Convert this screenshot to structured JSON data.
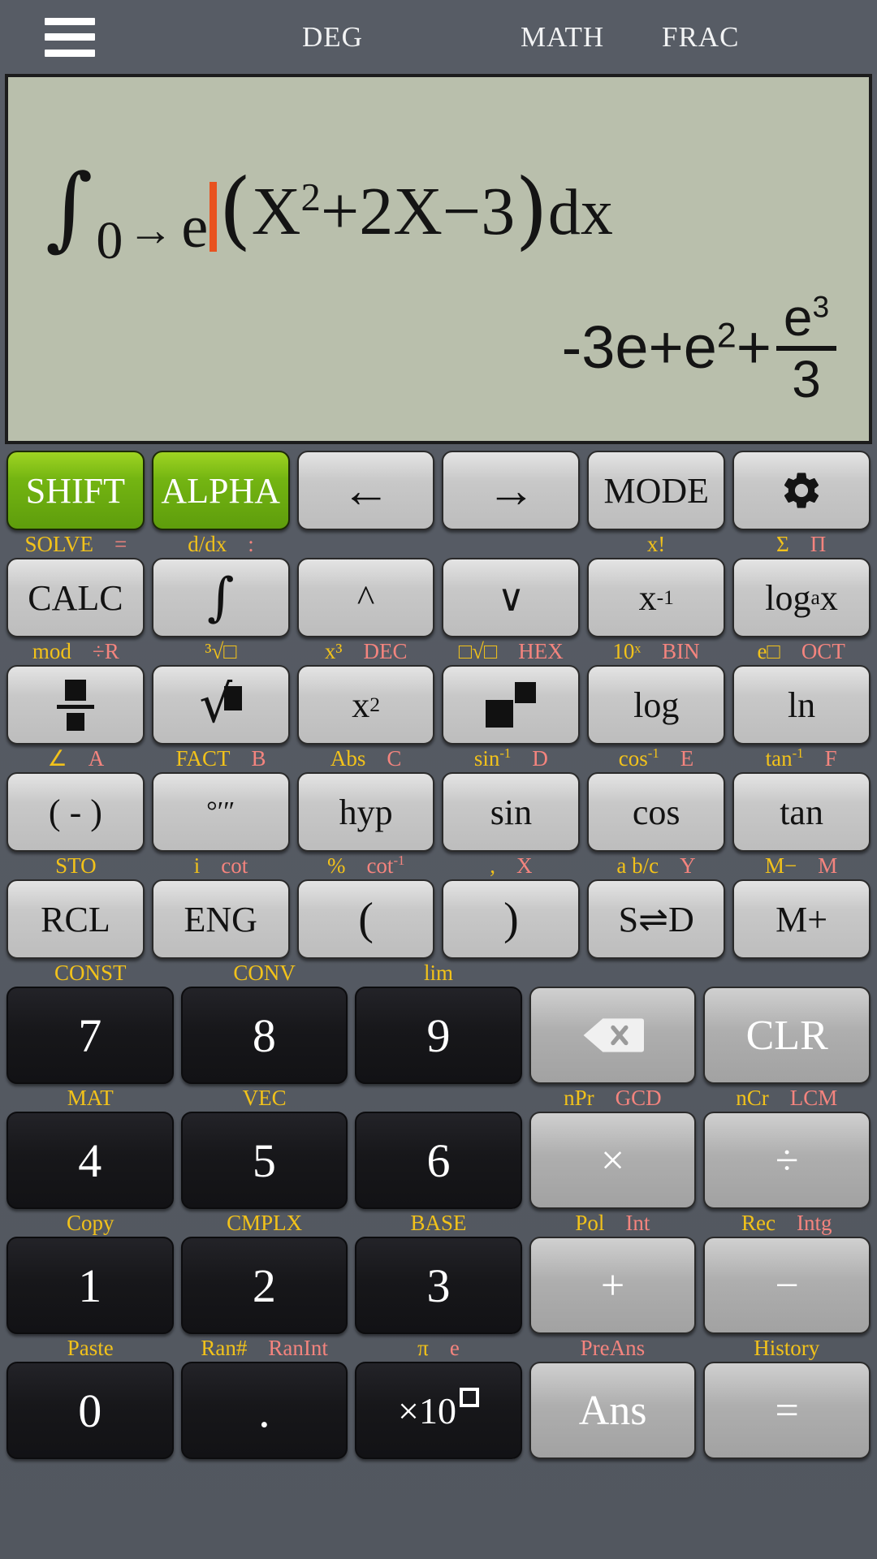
{
  "topbar": {
    "menu_icon": "hamburger-menu-icon",
    "angle_mode": "DEG",
    "display_mode": "MATH",
    "format_mode": "FRAC"
  },
  "display": {
    "expression": {
      "integral_symbol": "∫",
      "lower_limit": "0",
      "arrow": "→",
      "upper_limit": "e",
      "cursor": "|",
      "open_paren": "(",
      "body": "X2+2X−3",
      "body_parts": [
        "X",
        "2",
        "+2X−3"
      ],
      "close_paren": ")",
      "differential": "dx",
      "full_text": "∫0→e(X²+2X−3)dx"
    },
    "result": {
      "term1": "-3e+e",
      "term1_exp": "2",
      "plus": "+",
      "frac_num": "e",
      "frac_num_exp": "3",
      "frac_den": "3",
      "full_text": "-3e+e²+e³/3"
    }
  },
  "colors": {
    "shift_label": "#f2c21a",
    "alpha_label": "#f4847e",
    "accent_green": "#74b512",
    "display_bg": "#b9bfac",
    "cursor": "#e8521f",
    "body_bg": "#575c65"
  },
  "keypad": {
    "rows": [
      {
        "hints": [
          {
            "y": "",
            "r": ""
          },
          {
            "y": "",
            "r": ""
          },
          {
            "y": "",
            "r": ""
          },
          {
            "y": "",
            "r": ""
          },
          {
            "y": "",
            "r": ""
          },
          {
            "y": "",
            "r": ""
          }
        ],
        "keys": [
          {
            "label": "SHIFT",
            "style": "green",
            "name": "shift"
          },
          {
            "label": "ALPHA",
            "style": "green",
            "name": "alpha"
          },
          {
            "label": "←",
            "style": "light",
            "name": "arrow-left"
          },
          {
            "label": "→",
            "style": "light",
            "name": "arrow-right"
          },
          {
            "label": "MODE",
            "style": "light",
            "name": "mode"
          },
          {
            "label": "",
            "style": "light",
            "name": "settings-gear"
          }
        ]
      },
      {
        "hints": [
          {
            "y": "SOLVE",
            "r": "="
          },
          {
            "y": "d/dx",
            "r": ":"
          },
          {
            "y": "",
            "r": ""
          },
          {
            "y": "",
            "r": ""
          },
          {
            "y": "x!",
            "r": ""
          },
          {
            "y": "Σ",
            "r": "Π"
          }
        ],
        "keys": [
          {
            "label": "CALC",
            "style": "light",
            "name": "calc"
          },
          {
            "label": "∫",
            "style": "light",
            "name": "integral"
          },
          {
            "label": "˄",
            "style": "light",
            "name": "arrow-up"
          },
          {
            "label": "˅",
            "style": "light",
            "name": "arrow-down"
          },
          {
            "label": "x⁻¹",
            "style": "light",
            "name": "reciprocal"
          },
          {
            "label": "logₐx",
            "style": "light",
            "name": "log-base-a"
          }
        ]
      },
      {
        "hints": [
          {
            "y": "mod",
            "r": "÷R"
          },
          {
            "y": "³√□",
            "r": ""
          },
          {
            "y": "x³",
            "r": "DEC"
          },
          {
            "y": "□√□",
            "r": "HEX"
          },
          {
            "y": "10ˣ",
            "r": "BIN"
          },
          {
            "y": "e□",
            "r": "OCT"
          }
        ],
        "keys": [
          {
            "label": "",
            "style": "light",
            "name": "fraction"
          },
          {
            "label": "√□",
            "style": "light",
            "name": "square-root"
          },
          {
            "label": "x²",
            "style": "light",
            "name": "square"
          },
          {
            "label": "",
            "style": "light",
            "name": "power"
          },
          {
            "label": "log",
            "style": "light",
            "name": "log"
          },
          {
            "label": "ln",
            "style": "light",
            "name": "ln"
          }
        ]
      },
      {
        "hints": [
          {
            "y": "∠",
            "r": "A"
          },
          {
            "y": "FACT",
            "r": "B"
          },
          {
            "y": "Abs",
            "r": "C"
          },
          {
            "y": "sin⁻¹",
            "r": "D"
          },
          {
            "y": "cos⁻¹",
            "r": "E"
          },
          {
            "y": "tan⁻¹",
            "r": "F"
          }
        ],
        "keys": [
          {
            "label": "( - )",
            "style": "light",
            "name": "negative"
          },
          {
            "label": "°′″",
            "style": "light",
            "name": "degrees-minutes-seconds"
          },
          {
            "label": "hyp",
            "style": "light",
            "name": "hyp"
          },
          {
            "label": "sin",
            "style": "light",
            "name": "sin"
          },
          {
            "label": "cos",
            "style": "light",
            "name": "cos"
          },
          {
            "label": "tan",
            "style": "light",
            "name": "tan"
          }
        ]
      },
      {
        "hints": [
          {
            "y": "STO",
            "r": ""
          },
          {
            "y": "i",
            "r": "cot"
          },
          {
            "y": "%",
            "r": "cot⁻¹"
          },
          {
            "y": ",",
            "r": "X"
          },
          {
            "y": "a b/c",
            "r": "Y"
          },
          {
            "y": "M−",
            "r": "M"
          }
        ],
        "keys": [
          {
            "label": "RCL",
            "style": "light",
            "name": "rcl"
          },
          {
            "label": "ENG",
            "style": "light",
            "name": "eng"
          },
          {
            "label": "(",
            "style": "light",
            "name": "open-paren"
          },
          {
            "label": ")",
            "style": "light",
            "name": "close-paren"
          },
          {
            "label": "S⇌D",
            "style": "light",
            "name": "s-to-d"
          },
          {
            "label": "M+",
            "style": "light",
            "name": "memory-plus"
          }
        ]
      },
      {
        "hints": [
          {
            "y": "CONST",
            "r": ""
          },
          {
            "y": "CONV",
            "r": ""
          },
          {
            "y": "lim",
            "r": ""
          },
          {
            "y": "",
            "r": ""
          },
          {
            "y": "",
            "r": ""
          },
          {
            "y": "",
            "r": ""
          }
        ],
        "keys": [
          {
            "label": "7",
            "style": "dark",
            "name": "digit-7"
          },
          {
            "label": "8",
            "style": "dark",
            "name": "digit-8"
          },
          {
            "label": "9",
            "style": "dark",
            "name": "digit-9"
          },
          {
            "label": "",
            "style": "grayop",
            "name": "backspace"
          },
          {
            "label": "CLR",
            "style": "grayop",
            "name": "clear"
          }
        ]
      },
      {
        "hints": [
          {
            "y": "MAT",
            "r": ""
          },
          {
            "y": "VEC",
            "r": ""
          },
          {
            "y": "",
            "r": ""
          },
          {
            "y": "nPr",
            "r": "GCD"
          },
          {
            "y": "nCr",
            "r": "LCM"
          }
        ],
        "keys": [
          {
            "label": "4",
            "style": "dark",
            "name": "digit-4"
          },
          {
            "label": "5",
            "style": "dark",
            "name": "digit-5"
          },
          {
            "label": "6",
            "style": "dark",
            "name": "digit-6"
          },
          {
            "label": "×",
            "style": "grayop",
            "name": "multiply"
          },
          {
            "label": "÷",
            "style": "grayop",
            "name": "divide"
          }
        ]
      },
      {
        "hints": [
          {
            "y": "Copy",
            "r": ""
          },
          {
            "y": "CMPLX",
            "r": ""
          },
          {
            "y": "BASE",
            "r": ""
          },
          {
            "y": "Pol",
            "r": "Int"
          },
          {
            "y": "Rec",
            "r": "Intg"
          }
        ],
        "keys": [
          {
            "label": "1",
            "style": "dark",
            "name": "digit-1"
          },
          {
            "label": "2",
            "style": "dark",
            "name": "digit-2"
          },
          {
            "label": "3",
            "style": "dark",
            "name": "digit-3"
          },
          {
            "label": "+",
            "style": "grayop",
            "name": "plus"
          },
          {
            "label": "−",
            "style": "grayop",
            "name": "minus"
          }
        ]
      },
      {
        "hints": [
          {
            "y": "Paste",
            "r": ""
          },
          {
            "y": "Ran#",
            "r": "RanInt"
          },
          {
            "y": "π",
            "r": "e"
          },
          {
            "y": "PreAns",
            "r": ""
          },
          {
            "y": "History",
            "r": ""
          }
        ],
        "keys": [
          {
            "label": "0",
            "style": "dark",
            "name": "digit-0"
          },
          {
            "label": ".",
            "style": "dark",
            "name": "decimal-point"
          },
          {
            "label": "×10□",
            "style": "dark",
            "name": "exponent-ten"
          },
          {
            "label": "Ans",
            "style": "grayop",
            "name": "ans"
          },
          {
            "label": "=",
            "style": "grayop",
            "name": "equals"
          }
        ]
      }
    ]
  }
}
